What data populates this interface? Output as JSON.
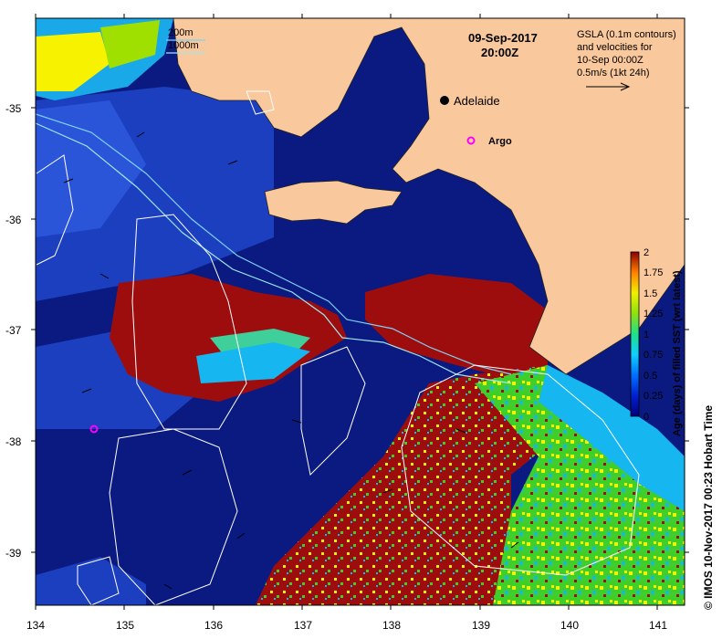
{
  "map": {
    "date_line": "09-Sep-2017",
    "time_line": "20:00Z",
    "depth_legend": {
      "line1": "200m",
      "line2": "1000m"
    },
    "gsla_note": [
      "GSLA (0.1m contours)",
      "and velocities for",
      "10-Sep 00:00Z",
      "0.5m/s (1kt 24h)"
    ],
    "places": [
      {
        "name": "Adelaide",
        "marker": "black-dot"
      },
      {
        "name": "Argo",
        "marker": "magenta-circle"
      }
    ],
    "x_ticks": [
      "134",
      "135",
      "136",
      "137",
      "138",
      "139",
      "140",
      "141"
    ],
    "y_ticks": [
      "-35",
      "-36",
      "-37",
      "-38",
      "-39"
    ],
    "colorbar": {
      "title": "Age (days) of filled SST (wrt latest)",
      "ticks": [
        "2",
        "1.75",
        "1.5",
        "1.25",
        "1",
        "0.75",
        "0.5",
        "0.25",
        "0"
      ],
      "range": [
        0,
        2
      ]
    },
    "credit": "© IMOS 10-Nov-2017 00:23 Hobart Time",
    "colors": {
      "land": "#f9c89c",
      "ocean_new": "#0a1a80",
      "ocean_mid": "#1c3fbf",
      "aged_warm": "#9e0d0d",
      "cyan": "#16b6f0",
      "green": "#3fcf2a",
      "yellow": "#f6f200",
      "contour": "#ffffff",
      "isobath_200": "#7fd2f5",
      "isobath_1000": "#9fe8f0",
      "argo": "#ff00ff"
    }
  }
}
